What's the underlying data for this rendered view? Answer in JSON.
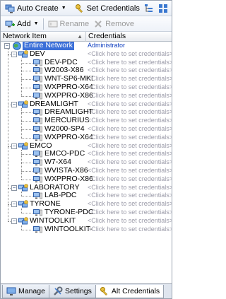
{
  "toolbar": {
    "auto_create_label": "Auto Create",
    "set_credentials_label": "Set Credentials",
    "add_label": "Add",
    "rename_label": "Rename",
    "remove_label": "Remove"
  },
  "columns": {
    "network_item": "Network Item",
    "credentials": "Credentials"
  },
  "tree": {
    "root": {
      "label": "Entire Network",
      "credentials": "Administrator"
    },
    "domains": [
      {
        "name": "DEV",
        "computers": [
          {
            "name": "DEV-PDC",
            "credentials": "<Click here to set credentials>"
          },
          {
            "name": "W2003-X86",
            "credentials": "<Click here to set credentials>"
          },
          {
            "name": "WNT-SP6-MKI",
            "credentials": "<Click here to set credentials>"
          },
          {
            "name": "WXPPRO-X64",
            "credentials": "<Click here to set credentials>"
          },
          {
            "name": "WXPPRO-X86",
            "credentials": "<Click here to set credentials>"
          }
        ],
        "credentials": "<Click here to set credentials>"
      },
      {
        "name": "DREAMLIGHT",
        "computers": [
          {
            "name": "DREAMLIGHT",
            "credentials": "<Click here to set credentials>"
          },
          {
            "name": "MERCURIUS",
            "credentials": "<Click here to set credentials>"
          },
          {
            "name": "W2000-SP4",
            "credentials": "<Click here to set credentials>"
          },
          {
            "name": "WXPPRO-X64",
            "credentials": "<Click here to set credentials>"
          }
        ],
        "credentials": "<Click here to set credentials>"
      },
      {
        "name": "EMCO",
        "computers": [
          {
            "name": "EMCO-PDC",
            "credentials": "<Click here to set credentials>"
          },
          {
            "name": "W7-X64",
            "credentials": "<Click here to set credentials>"
          },
          {
            "name": "WVISTA-X86",
            "credentials": "<Click here to set credentials>"
          },
          {
            "name": "WXPPRO-X86",
            "credentials": "<Click here to set credentials>"
          }
        ],
        "credentials": "<Click here to set credentials>"
      },
      {
        "name": "LABORATORY",
        "computers": [
          {
            "name": "LAB-PDC",
            "credentials": "<Click here to set credentials>"
          }
        ],
        "credentials": "<Click here to set credentials>"
      },
      {
        "name": "TYRONE",
        "computers": [
          {
            "name": "TYRONE-PDC",
            "credentials": "<Click here to set credentials>"
          }
        ],
        "credentials": "<Click here to set credentials>"
      },
      {
        "name": "WINTOOLKIT",
        "computers": [
          {
            "name": "WINTOOLKIT-",
            "credentials": "<Click here to set credentials>"
          }
        ],
        "credentials": "<Click here to set credentials>"
      }
    ]
  },
  "bottom_tabs": [
    {
      "label": "Manage",
      "icon": "monitor-icon"
    },
    {
      "label": "Settings",
      "icon": "wrench-icon"
    },
    {
      "label": "Alt Credentials",
      "icon": "key-icon"
    }
  ],
  "colors": {
    "selection": "#3b6fd8",
    "admin_text": "#1040c0",
    "placeholder_text": "#9a9aa8"
  }
}
